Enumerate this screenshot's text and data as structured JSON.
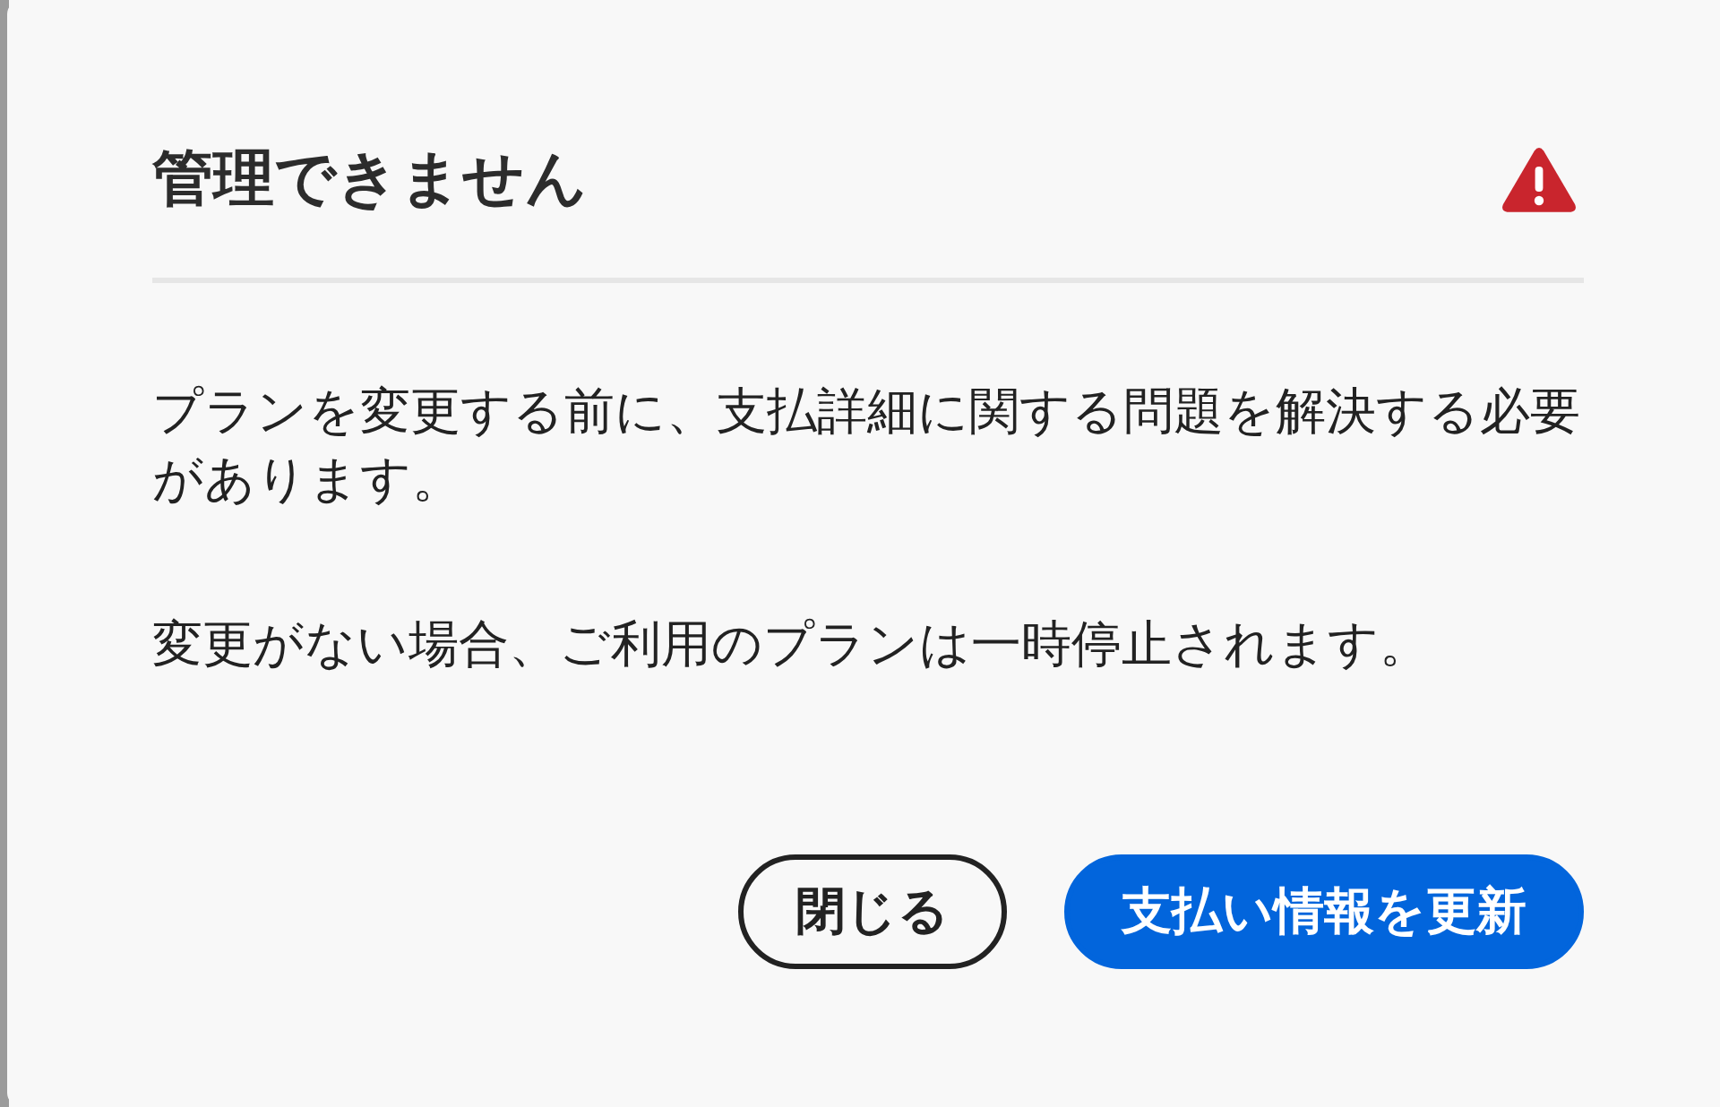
{
  "dialog": {
    "title": "管理できません",
    "paragraphs": [
      "プランを変更する前に、支払詳細に関する問題を解決する必要があります。",
      "変更がない場合、ご利用のプランは一時停止されます。"
    ],
    "buttons": [
      {
        "label": "閉じる",
        "kind": "secondary"
      },
      {
        "label": "支払い情報を更新",
        "kind": "primary"
      }
    ]
  }
}
